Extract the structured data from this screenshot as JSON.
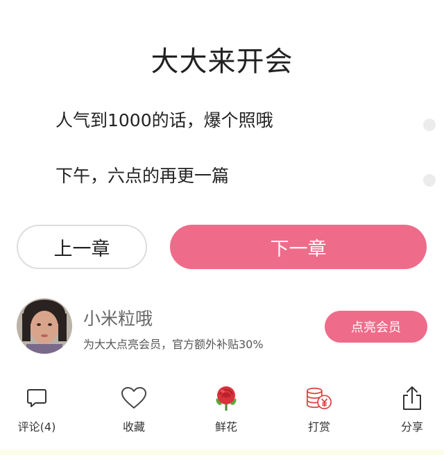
{
  "chapter": {
    "title": "大大来开会",
    "paragraphs": [
      "人气到1000的话，爆个照哦",
      "下午，六点的再更一篇"
    ]
  },
  "nav": {
    "prev_label": "上一章",
    "next_label": "下一章"
  },
  "author": {
    "name": "小米粒哦",
    "promo": "为大大点亮会员，官方额外补贴30%",
    "vip_button": "点亮会员"
  },
  "actions": [
    {
      "label": "评论(4)",
      "icon": "comment-icon"
    },
    {
      "label": "收藏",
      "icon": "heart-icon"
    },
    {
      "label": "鲜花",
      "icon": "rose-icon"
    },
    {
      "label": "打赏",
      "icon": "coins-icon"
    },
    {
      "label": "分享",
      "icon": "share-icon"
    }
  ],
  "colors": {
    "accent": "#ee6c8a",
    "border": "#dddddd"
  }
}
